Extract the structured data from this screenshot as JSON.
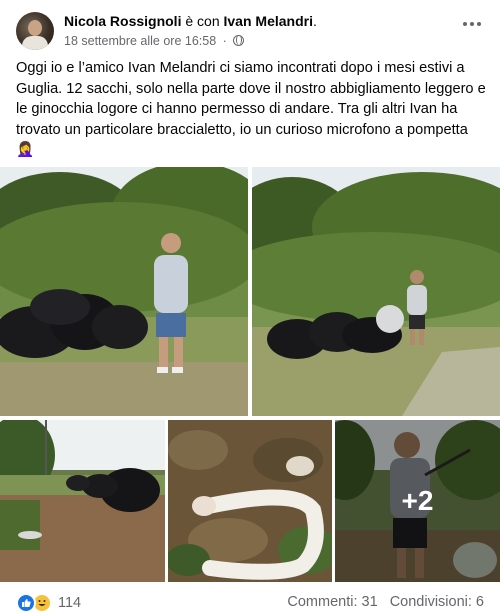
{
  "post": {
    "author": "Nicola Rossignoli",
    "with_text": "è con",
    "tagged": "Ivan Melandri",
    "tagged_suffix": ".",
    "date": "18 settembre alle ore 16:58",
    "separator": "·",
    "privacy_icon": "globe-icon",
    "text": "Oggi io e l’amico Ivan Melandri ci siamo incontrati dopo i mesi estivi a Guglia. 12 sacchi, solo nella parte dove il nostro abbigliamento leggero e le ginocchia logore ci hanno permesso di andare. Tra gli altri Ivan ha trovato un particolare braccialetto, io un curioso microfono a pompetta 🤦‍♀️"
  },
  "photos": {
    "more_label": "+2"
  },
  "footer": {
    "reaction_icons": [
      "like-icon",
      "haha-icon"
    ],
    "reaction_count": "114",
    "comments": "Commenti: 31",
    "shares": "Condivisioni: 6"
  },
  "colors": {
    "text": "#050505",
    "secondary": "#65676b",
    "like_blue": "#1b74e4",
    "haha_yellow": "#f7c23a"
  }
}
